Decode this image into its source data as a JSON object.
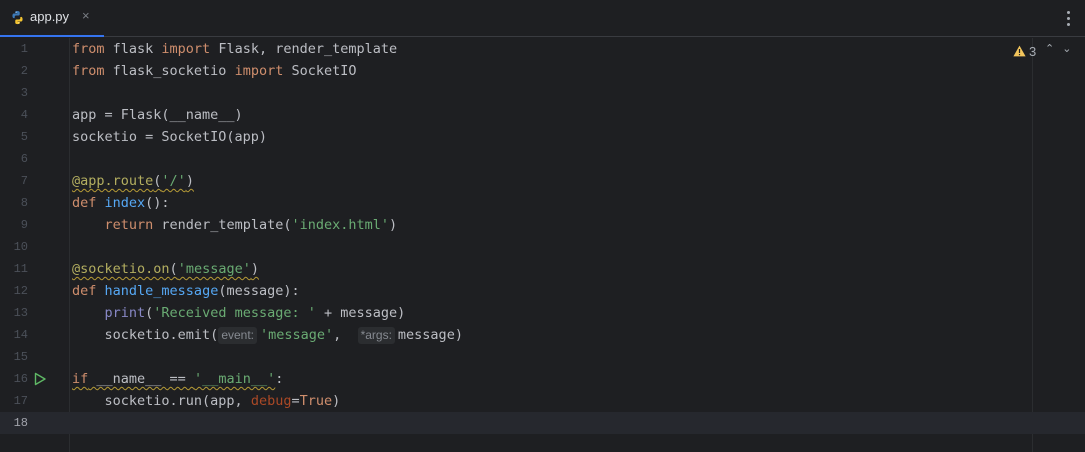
{
  "tab": {
    "filename": "app.py",
    "close_glyph": "×",
    "file_icon": "python-file-icon"
  },
  "inspections": {
    "icon": "warning-triangle-icon",
    "warning_count": "3",
    "prev_glyph": "⌃",
    "next_glyph": "⌄"
  },
  "colors": {
    "background": "#1e1f22",
    "keyword": "#cf8e6d",
    "function": "#56a8f5",
    "string": "#6aab73",
    "decorator": "#b3ae60",
    "builtin": "#8888c6",
    "named_param": "#aa4926",
    "tab_underline": "#3574f0"
  },
  "editor": {
    "current_line": 18,
    "run_gutter_line": 16,
    "lines": [
      {
        "n": "1",
        "tokens": [
          {
            "t": "from",
            "c": "kw"
          },
          {
            "t": " flask ",
            "c": "plain"
          },
          {
            "t": "import",
            "c": "kw"
          },
          {
            "t": " Flask, render_template",
            "c": "plain"
          }
        ]
      },
      {
        "n": "2",
        "tokens": [
          {
            "t": "from",
            "c": "kw"
          },
          {
            "t": " flask_socketio ",
            "c": "plain"
          },
          {
            "t": "import",
            "c": "kw"
          },
          {
            "t": " SocketIO",
            "c": "plain"
          }
        ]
      },
      {
        "n": "3",
        "tokens": []
      },
      {
        "n": "4",
        "tokens": [
          {
            "t": "app = Flask(__name__)",
            "c": "plain"
          }
        ]
      },
      {
        "n": "5",
        "tokens": [
          {
            "t": "socketio = SocketIO(app)",
            "c": "plain"
          }
        ]
      },
      {
        "n": "6",
        "tokens": []
      },
      {
        "n": "7",
        "tokens": [
          {
            "t": "@app.route",
            "c": "dec warn"
          },
          {
            "t": "(",
            "c": "plain warn"
          },
          {
            "t": "'/'",
            "c": "str warn"
          },
          {
            "t": ")",
            "c": "plain warn"
          }
        ]
      },
      {
        "n": "8",
        "tokens": [
          {
            "t": "def",
            "c": "kw"
          },
          {
            "t": " ",
            "c": "plain"
          },
          {
            "t": "index",
            "c": "fn"
          },
          {
            "t": "():",
            "c": "plain"
          }
        ]
      },
      {
        "n": "9",
        "tokens": [
          {
            "t": "    ",
            "c": "plain"
          },
          {
            "t": "return",
            "c": "kw"
          },
          {
            "t": " render_template(",
            "c": "plain"
          },
          {
            "t": "'index.html'",
            "c": "str"
          },
          {
            "t": ")",
            "c": "plain"
          }
        ]
      },
      {
        "n": "10",
        "tokens": []
      },
      {
        "n": "11",
        "tokens": [
          {
            "t": "@socketio.on",
            "c": "dec warn"
          },
          {
            "t": "(",
            "c": "plain warn"
          },
          {
            "t": "'message'",
            "c": "str warn"
          },
          {
            "t": ")",
            "c": "plain warn"
          }
        ]
      },
      {
        "n": "12",
        "tokens": [
          {
            "t": "def",
            "c": "kw"
          },
          {
            "t": " ",
            "c": "plain"
          },
          {
            "t": "handle_message",
            "c": "fn"
          },
          {
            "t": "(message):",
            "c": "plain"
          }
        ]
      },
      {
        "n": "13",
        "tokens": [
          {
            "t": "    ",
            "c": "plain"
          },
          {
            "t": "print",
            "c": "bi"
          },
          {
            "t": "(",
            "c": "plain"
          },
          {
            "t": "'Received message: '",
            "c": "str"
          },
          {
            "t": " + message)",
            "c": "plain"
          }
        ]
      },
      {
        "n": "14",
        "tokens": [
          {
            "t": "    socketio.emit(",
            "c": "plain"
          },
          {
            "t": "event:",
            "c": "hint"
          },
          {
            "t": "'message'",
            "c": "str"
          },
          {
            "t": ",  ",
            "c": "plain"
          },
          {
            "t": "*args:",
            "c": "hint"
          },
          {
            "t": "message)",
            "c": "plain"
          }
        ]
      },
      {
        "n": "15",
        "tokens": []
      },
      {
        "n": "16",
        "tokens": [
          {
            "t": "if",
            "c": "kw warn"
          },
          {
            "t": " __name__ == ",
            "c": "plain warn"
          },
          {
            "t": "'__main__'",
            "c": "str warn"
          },
          {
            "t": ":",
            "c": "plain"
          }
        ]
      },
      {
        "n": "17",
        "tokens": [
          {
            "t": "    socketio.run(app, ",
            "c": "plain"
          },
          {
            "t": "debug",
            "c": "param"
          },
          {
            "t": "=",
            "c": "plain"
          },
          {
            "t": "True",
            "c": "kw"
          },
          {
            "t": ")",
            "c": "plain"
          }
        ]
      },
      {
        "n": "18",
        "tokens": []
      }
    ]
  }
}
